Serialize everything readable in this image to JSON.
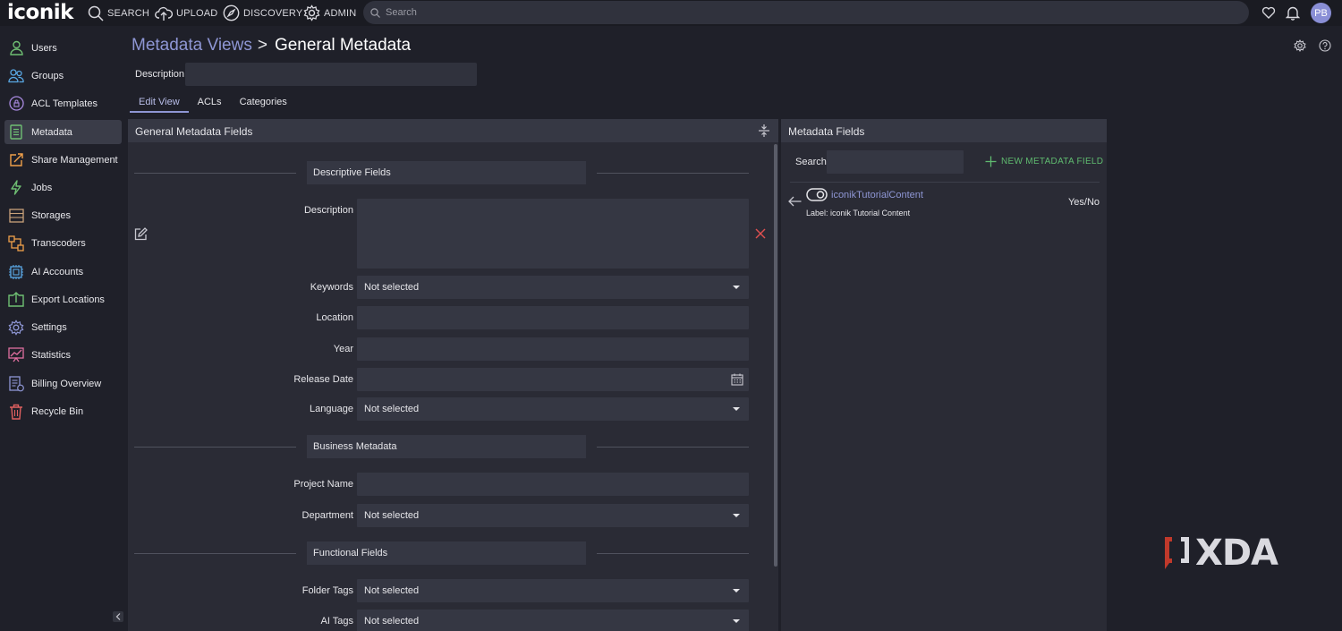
{
  "app": {
    "logo": "iconik"
  },
  "topnav": {
    "items": [
      {
        "label": "SEARCH",
        "icon": "search-icon"
      },
      {
        "label": "UPLOAD",
        "icon": "cloud-upload-icon"
      },
      {
        "label": "DISCOVERY",
        "icon": "compass-icon"
      },
      {
        "label": "ADMIN",
        "icon": "gear-icon"
      }
    ],
    "search_placeholder": "Search",
    "avatar_initials": "PB"
  },
  "sidebar": {
    "items": [
      {
        "label": "Users",
        "icon": "user-icon",
        "color": "#6fbf73"
      },
      {
        "label": "Groups",
        "icon": "group-icon",
        "color": "#5aa9e6"
      },
      {
        "label": "ACL Templates",
        "icon": "lock-icon",
        "color": "#a98ae0"
      },
      {
        "label": "Metadata",
        "icon": "document-icon",
        "color": "#6fbf73",
        "active": true
      },
      {
        "label": "Share Management",
        "icon": "share-icon",
        "color": "#f0a04b"
      },
      {
        "label": "Jobs",
        "icon": "lightning-icon",
        "color": "#6fbf73"
      },
      {
        "label": "Storages",
        "icon": "storage-icon",
        "color": "#c9a27a"
      },
      {
        "label": "Transcoders",
        "icon": "transcoder-icon",
        "color": "#f0a04b"
      },
      {
        "label": "AI Accounts",
        "icon": "chip-icon",
        "color": "#5aa9e6"
      },
      {
        "label": "Export Locations",
        "icon": "export-icon",
        "color": "#6fbf73"
      },
      {
        "label": "Settings",
        "icon": "settings-icon",
        "color": "#8e96d4"
      },
      {
        "label": "Statistics",
        "icon": "statistics-icon",
        "color": "#e06fa0"
      },
      {
        "label": "Billing Overview",
        "icon": "billing-icon",
        "color": "#8e96d4"
      },
      {
        "label": "Recycle Bin",
        "icon": "trash-icon",
        "color": "#e06060"
      }
    ]
  },
  "header": {
    "breadcrumb_parent": "Metadata Views",
    "breadcrumb_separator": ">",
    "breadcrumb_current": "General Metadata",
    "description_label": "Description",
    "description_value": ""
  },
  "tabs": [
    {
      "label": "Edit View",
      "active": true
    },
    {
      "label": "ACLs"
    },
    {
      "label": "Categories"
    }
  ],
  "left_panel": {
    "title": "General Metadata Fields",
    "sections": [
      {
        "label": "Descriptive Fields"
      },
      {
        "label": "Business Metadata"
      },
      {
        "label": "Functional Fields"
      }
    ],
    "fields": {
      "description": {
        "label": "Description",
        "value": ""
      },
      "keywords": {
        "label": "Keywords",
        "value": "Not selected"
      },
      "location": {
        "label": "Location",
        "value": ""
      },
      "year": {
        "label": "Year",
        "value": ""
      },
      "release_date": {
        "label": "Release Date",
        "value": ""
      },
      "language": {
        "label": "Language",
        "value": "Not selected"
      },
      "project_name": {
        "label": "Project Name",
        "value": ""
      },
      "department": {
        "label": "Department",
        "value": "Not selected"
      },
      "folder_tags": {
        "label": "Folder Tags",
        "value": "Not selected"
      },
      "ai_tags": {
        "label": "AI Tags",
        "value": "Not selected"
      }
    }
  },
  "right_panel": {
    "title": "Metadata Fields",
    "search_label": "Search",
    "search_value": "",
    "new_field_label": "NEW METADATA FIELD",
    "fields": [
      {
        "name": "iconikTutorialContent",
        "label": "Label: iconik Tutorial Content",
        "type": "Yes/No"
      }
    ]
  },
  "watermark": {
    "text": "XDA"
  },
  "colors": {
    "accent": "#8e96d4",
    "success": "#5fba6f",
    "danger": "#e05050",
    "background": "#1f2029",
    "panel": "#2a2b35"
  }
}
